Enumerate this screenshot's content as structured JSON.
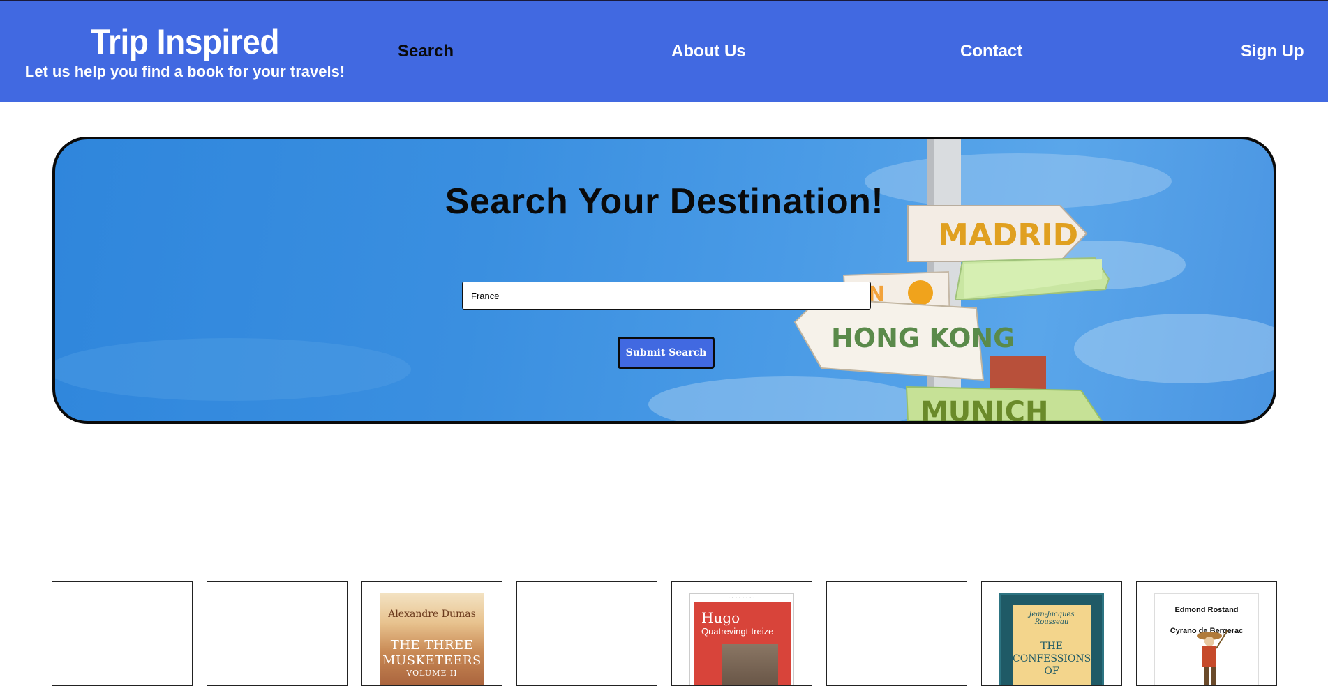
{
  "header": {
    "title": "Trip Inspired",
    "tagline": "Let us help you find a book for your travels!",
    "nav": {
      "search": "Search",
      "about": "About Us",
      "contact": "Contact",
      "signup": "Sign Up"
    }
  },
  "hero": {
    "heading": "Search Your Destination!",
    "search_value": "France",
    "submit_label": "Submit Search",
    "background_signs": [
      "MADRID",
      "HONG KONG",
      "MUNICH"
    ]
  },
  "results": [
    {
      "cover": "none"
    },
    {
      "cover": "none"
    },
    {
      "cover": "image",
      "author": "Alexandre Dumas",
      "title": "THE THREE MUSKETEERS",
      "subtitle": "VOLUME II"
    },
    {
      "cover": "none"
    },
    {
      "cover": "image",
      "author": "Hugo",
      "title": "Quatrevingt-treize"
    },
    {
      "cover": "none"
    },
    {
      "cover": "image",
      "author": "Jean-Jacques Rousseau",
      "title": "THE CONFESSIONS OF"
    },
    {
      "cover": "image",
      "author": "Edmond Rostand",
      "title": "Cyrano de Bergerac"
    }
  ],
  "colors": {
    "accent": "#4169e1",
    "active_nav": "#0a0a0a",
    "sky": "#3a8fe0"
  }
}
